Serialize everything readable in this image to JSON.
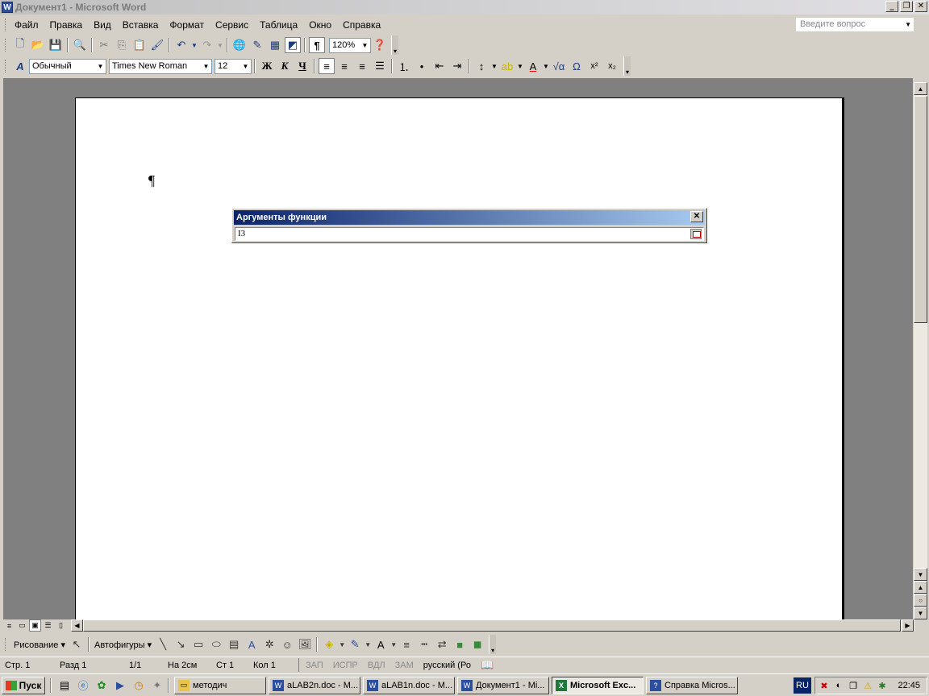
{
  "window": {
    "title": "Документ1 - Microsoft Word",
    "icon": "word-app-icon"
  },
  "menu": {
    "items": [
      "Файл",
      "Правка",
      "Вид",
      "Вставка",
      "Формат",
      "Сервис",
      "Таблица",
      "Окно",
      "Справка"
    ],
    "help_placeholder": "Введите вопрос"
  },
  "standard_toolbar": {
    "zoom": "120%",
    "icons": [
      "new-icon",
      "open-icon",
      "save-icon",
      "print-preview-icon",
      "cut-icon",
      "copy-icon",
      "paste-icon",
      "format-painter-icon",
      "undo-icon",
      "redo-icon",
      "hyperlink-icon",
      "tables-borders-icon",
      "insert-table-icon",
      "drawing-icon",
      "show-formatting-icon",
      "help-icon"
    ]
  },
  "formatting_toolbar": {
    "style": "Обычный",
    "font": "Times New Roman",
    "size": "12",
    "bold": "Ж",
    "italic": "К",
    "underline": "Ч"
  },
  "document": {
    "paragraph_mark": "¶"
  },
  "function_dialog": {
    "title": "Аргументы функции",
    "value": "I3"
  },
  "drawing_toolbar": {
    "draw_label": "Рисование",
    "autoshapes_label": "Автофигуры"
  },
  "status_bar": {
    "page": "Стр.  1",
    "section": "Разд  1",
    "pages": "1/1",
    "at": "На  2см",
    "line": "Ст  1",
    "col": "Кол  1",
    "rec": "ЗАП",
    "trk": "ИСПР",
    "ext": "ВДЛ",
    "ovr": "ЗАМ",
    "language": "русский (Ро"
  },
  "taskbar": {
    "start": "Пуск",
    "tasks": [
      {
        "label": "методич",
        "icon": "folder-icon"
      },
      {
        "label": "aLAB2n.doc - M...",
        "icon": "word-icon"
      },
      {
        "label": "aLAB1n.doc - M...",
        "icon": "word-icon"
      },
      {
        "label": "Документ1 - Mi...",
        "icon": "word-icon"
      },
      {
        "label": "Microsoft Exc...",
        "icon": "excel-icon",
        "active": true
      },
      {
        "label": "Справка Micros...",
        "icon": "help-icon"
      }
    ],
    "language": "RU",
    "clock": "22:45"
  },
  "colors": {
    "dialog_caption_start": "#0a246a",
    "dialog_caption_end": "#a6caf0",
    "workspace": "#808080"
  }
}
